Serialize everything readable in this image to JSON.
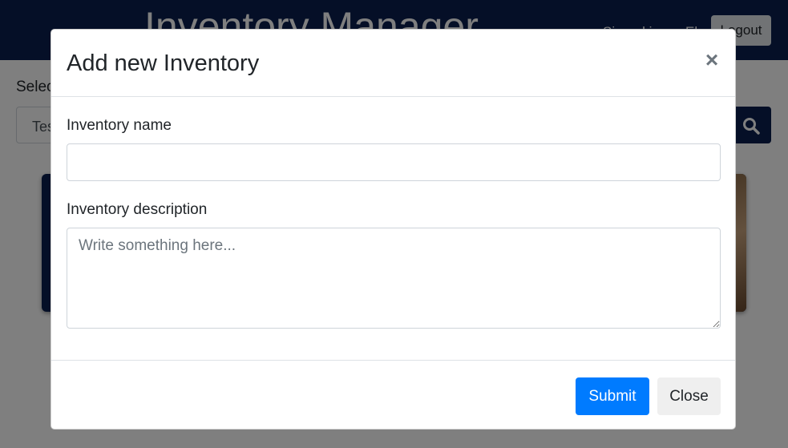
{
  "background": {
    "app_title": "Inventory Manager",
    "user_name": "Signed in as: Ela",
    "logout_label": "Logout",
    "select_label": "Select",
    "select_value": "Test"
  },
  "modal": {
    "title": "Add new Inventory",
    "close_x": "×",
    "name_label": "Inventory name",
    "name_value": "",
    "description_label": "Inventory description",
    "description_placeholder": "Write something here...",
    "submit_label": "Submit",
    "close_label": "Close"
  },
  "icons": {
    "search": "search-icon",
    "close": "close-icon"
  },
  "colors": {
    "navbar": "#0a1f4e",
    "primary": "#007bff",
    "backdrop": "rgba(0,0,0,0.5)"
  }
}
